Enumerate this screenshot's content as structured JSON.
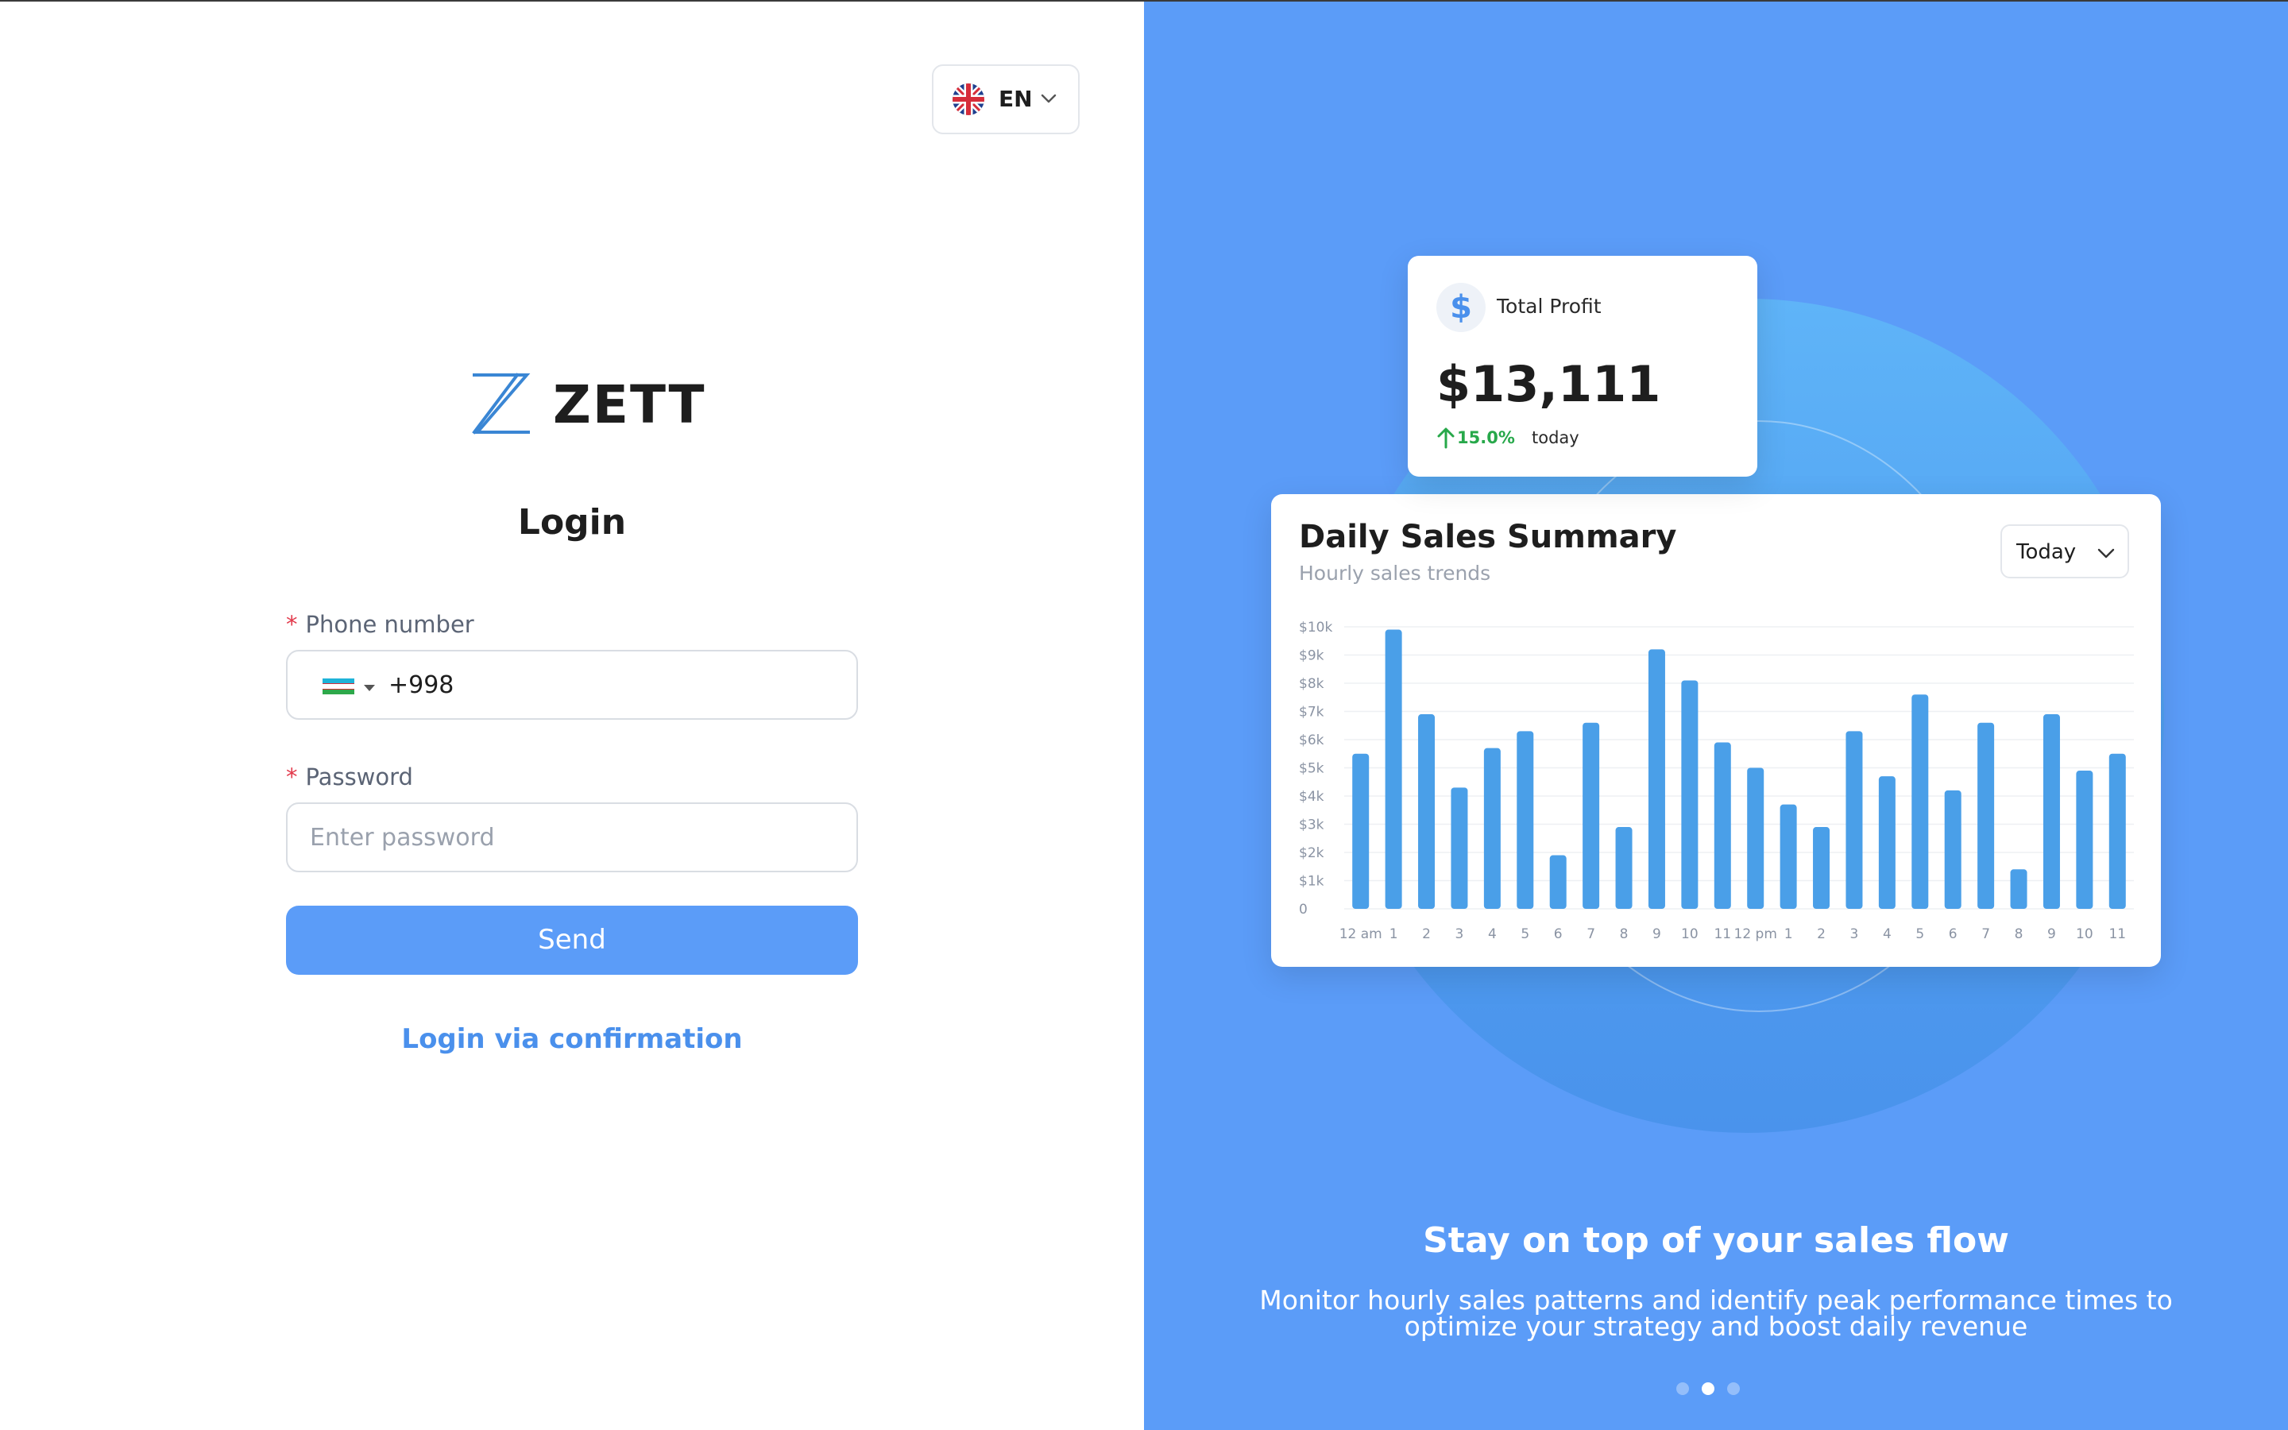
{
  "language": {
    "code": "EN",
    "flag_icon": "uk-flag-icon"
  },
  "brand": {
    "name": "ZETT",
    "logo_color": "#3a86d4"
  },
  "login": {
    "title": "Login",
    "phone_label": "Phone number",
    "phone_prefix": "+998",
    "phone_country_icon": "uzbekistan-flag-icon",
    "password_label": "Password",
    "password_placeholder": "Enter password",
    "required_mark": "*",
    "send_label": "Send",
    "confirm_link": "Login via confirmation"
  },
  "promo": {
    "profit_card": {
      "icon": "dollar-icon",
      "icon_glyph": "$",
      "label": "Total Profit",
      "amount": "$13,111",
      "change": "15.0%",
      "change_suffix": "today"
    },
    "sales_card": {
      "title": "Daily Sales Summary",
      "subtitle": "Hourly sales trends",
      "period": "Today"
    },
    "headline": "Stay on top of your sales flow",
    "description_line1": "Monitor hourly sales patterns and identify peak performance times to",
    "description_line2": "optimize your strategy and boost daily revenue",
    "carousel": {
      "count": 3,
      "active_index": 1
    }
  },
  "colors": {
    "accent": "#5b9cf8",
    "link": "#4a90ec",
    "bar": "#4a9fe8",
    "positive": "#27a84a",
    "required": "#e23a4c"
  },
  "chart_data": {
    "type": "bar",
    "title": "Daily Sales Summary",
    "subtitle": "Hourly sales trends",
    "categories": [
      "12 am",
      "1",
      "2",
      "3",
      "4",
      "5",
      "6",
      "7",
      "8",
      "9",
      "10",
      "11",
      "12 pm",
      "1",
      "2",
      "3",
      "4",
      "5",
      "6",
      "7",
      "8",
      "9",
      "10",
      "11"
    ],
    "values": [
      5500,
      9900,
      6900,
      4300,
      5700,
      6300,
      1900,
      6600,
      2900,
      9200,
      8100,
      5900,
      5000,
      3700,
      2900,
      6300,
      4700,
      7600,
      4200,
      6600,
      1400,
      6900,
      4900,
      5500
    ],
    "y_ticks": [
      "0",
      "$1k",
      "$2k",
      "$3k",
      "$4k",
      "$5k",
      "$6k",
      "$7k",
      "$8k",
      "$9k",
      "$10k"
    ],
    "ylim": [
      0,
      10000
    ],
    "grid": true,
    "xlabel": "",
    "ylabel": ""
  }
}
